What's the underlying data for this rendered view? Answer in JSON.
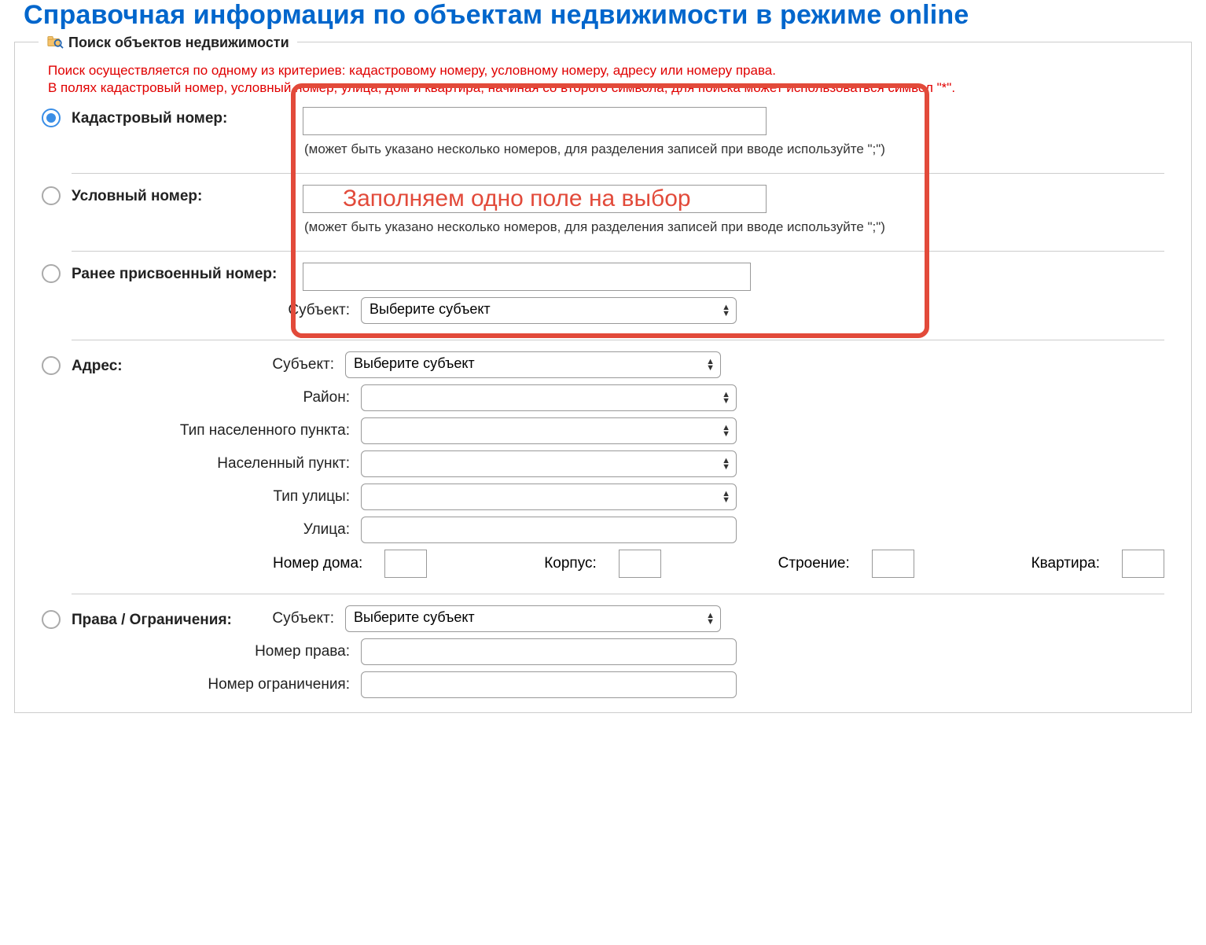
{
  "page_title": "Справочная информация по объектам недвижимости в режиме online",
  "panel_title": "Поиск объектов недвижимости",
  "hint_line1": "Поиск осуществляется по одному из критериев: кадастровому номеру, условному номеру, адресу или номеру права.",
  "hint_line2": "В полях кадастровый номер, условный номер, улица, дом и квартира, начиная со второго символа, для поиска может использоваться символ \"*\".",
  "annotation_text": "Заполняем одно поле на выбор",
  "criteria": {
    "cadastral": {
      "label": "Кадастровый номер:",
      "helper": "(может быть указано несколько номеров, для разделения записей при вводе используйте \";\")",
      "value": ""
    },
    "conditional": {
      "label": "Условный номер:",
      "helper": "(может быть указано несколько номеров, для разделения записей при вводе используйте \";\")",
      "value": ""
    },
    "previous": {
      "label": "Ранее присвоенный номер:",
      "value": "",
      "subject_label": "Субъект:",
      "subject_selected": "Выберите субъект"
    },
    "address": {
      "label": "Адрес:",
      "subject_label": "Субъект:",
      "subject_selected": "Выберите субъект",
      "district_label": "Район:",
      "district_selected": "",
      "settlement_type_label": "Тип населенного пункта:",
      "settlement_type_selected": "",
      "settlement_label": "Населенный пункт:",
      "settlement_selected": "",
      "street_type_label": "Тип улицы:",
      "street_type_selected": "",
      "street_label": "Улица:",
      "street_value": "",
      "house_label": "Номер дома:",
      "house_value": "",
      "korpus_label": "Корпус:",
      "korpus_value": "",
      "building_label": "Строение:",
      "building_value": "",
      "flat_label": "Квартира:",
      "flat_value": ""
    },
    "rights": {
      "label": "Права / Ограничения:",
      "subject_label": "Субъект:",
      "subject_selected": "Выберите субъект",
      "right_no_label": "Номер права:",
      "right_no_value": "",
      "restriction_no_label": "Номер ограничения:",
      "restriction_no_value": ""
    }
  }
}
